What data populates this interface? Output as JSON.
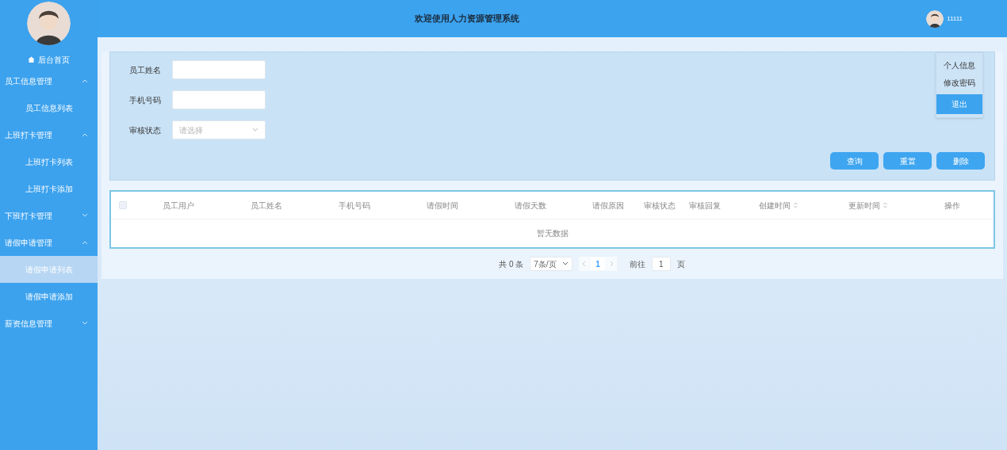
{
  "sidebar": {
    "home": "后台首页",
    "menus": [
      {
        "label": "员工信息管理",
        "expanded": true,
        "children": [
          {
            "label": "员工信息列表",
            "selected": false
          }
        ]
      },
      {
        "label": "上班打卡管理",
        "expanded": true,
        "children": [
          {
            "label": "上班打卡列表",
            "selected": false
          },
          {
            "label": "上班打卡添加",
            "selected": false
          }
        ]
      },
      {
        "label": "下班打卡管理",
        "expanded": false
      },
      {
        "label": "请假申请管理",
        "expanded": true,
        "children": [
          {
            "label": "请假申请列表",
            "selected": true
          },
          {
            "label": "请假申请添加",
            "selected": false
          }
        ]
      },
      {
        "label": "薪资信息管理",
        "expanded": false
      }
    ]
  },
  "header": {
    "title": "欢迎使用人力资源管理系统",
    "user": "11111"
  },
  "user_menu": [
    {
      "label": "个人信息",
      "selected": false
    },
    {
      "label": "修改密码",
      "selected": false
    },
    {
      "label": "退出",
      "selected": true
    }
  ],
  "search": {
    "fields": [
      {
        "kind": "input",
        "label": "员工姓名"
      },
      {
        "kind": "input",
        "label": "手机号码"
      },
      {
        "kind": "select",
        "label": "审核状态",
        "placeholder": "请选择"
      }
    ],
    "buttons": [
      "查询",
      "重置",
      "删除"
    ]
  },
  "table": {
    "select_all": {
      "checked": false
    },
    "columns": [
      {
        "label": "员工用户",
        "sortable": false
      },
      {
        "label": "员工姓名",
        "sortable": false
      },
      {
        "label": "手机号码",
        "sortable": false
      },
      {
        "label": "请假时间",
        "sortable": false
      },
      {
        "label": "请假天数",
        "sortable": false
      },
      {
        "label": "请假原因",
        "sortable": false
      },
      {
        "label": "审核状态",
        "sortable": false
      },
      {
        "label": "审核回复",
        "sortable": false
      },
      {
        "label": "创建时间",
        "sortable": true
      },
      {
        "label": "更新时间",
        "sortable": true
      },
      {
        "label": "操作",
        "sortable": false
      }
    ],
    "empty_text": "暂无数据"
  },
  "pagination": {
    "total": "共 0 条",
    "page_size": "7条/页",
    "pages": [
      {
        "label": "1",
        "selected": true
      }
    ],
    "goto_label": "前往",
    "goto_value": "1",
    "goto_suffix": "页"
  }
}
